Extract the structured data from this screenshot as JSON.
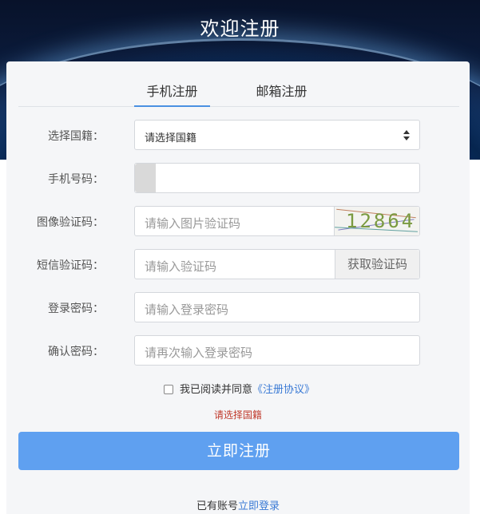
{
  "header": {
    "title": "欢迎注册"
  },
  "tabs": [
    {
      "label": "手机注册",
      "active": true
    },
    {
      "label": "邮箱注册",
      "active": false
    }
  ],
  "form": {
    "nationality": {
      "label": "选择国籍：",
      "value": "请选择国籍"
    },
    "phone": {
      "label": "手机号码：",
      "value": ""
    },
    "image_captcha": {
      "label": "图像验证码：",
      "placeholder": "请输入图片验证码",
      "captcha_text": "12864"
    },
    "sms_code": {
      "label": "短信验证码：",
      "placeholder": "请输入验证码",
      "button": "获取验证码"
    },
    "password": {
      "label": "登录密码：",
      "placeholder": "请输入登录密码"
    },
    "confirm_password": {
      "label": "确认密码：",
      "placeholder": "请再次输入登录密码"
    }
  },
  "agreement": {
    "text": "我已阅读并同意",
    "link": "《注册协议》",
    "checked": false
  },
  "error_message": "请选择国籍",
  "submit_label": "立即注册",
  "footer": {
    "text": "已有账号",
    "link": "立即登录"
  },
  "colors": {
    "accent": "#5fa0f0",
    "link": "#3a7ad5",
    "error": "#c0392b"
  }
}
